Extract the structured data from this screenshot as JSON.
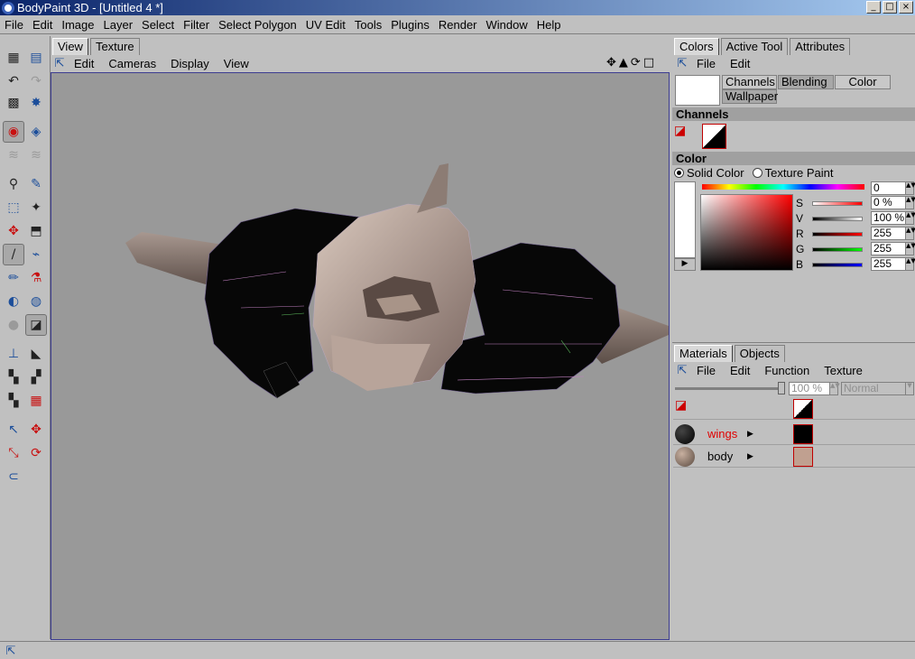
{
  "window": {
    "title": "BodyPaint 3D - [Untitled 4 *]",
    "minimize": "_",
    "maximize": "□",
    "close": "×"
  },
  "menubar": [
    "File",
    "Edit",
    "Image",
    "Layer",
    "Select",
    "Filter",
    "Select Polygon",
    "UV Edit",
    "Tools",
    "Plugins",
    "Render",
    "Window",
    "Help"
  ],
  "viewport": {
    "tabs": [
      "View",
      "Texture"
    ],
    "menu": [
      "Edit",
      "Cameras",
      "Display",
      "View"
    ],
    "controls": [
      "✥",
      "▲",
      "⟳",
      "□"
    ],
    "background": "#999999"
  },
  "colors_panel": {
    "tabs": [
      "Colors",
      "Active Tool",
      "Attributes"
    ],
    "menu": [
      "File",
      "Edit"
    ],
    "channel_buttons": [
      "Channels",
      "Blending",
      "Color",
      "Wallpaper"
    ],
    "channels_header": "Channels",
    "color_header": "Color",
    "mode_solid": "Solid Color",
    "mode_texture": "Texture Paint",
    "top_value": "0",
    "sliders": [
      {
        "label": "S",
        "value": "0 %",
        "gradient": "linear-gradient(90deg,#fff,#f00)"
      },
      {
        "label": "V",
        "value": "100 %",
        "gradient": "linear-gradient(90deg,#000,#fff)"
      },
      {
        "label": "R",
        "value": "255",
        "gradient": "linear-gradient(90deg,#000,#f00)"
      },
      {
        "label": "G",
        "value": "255",
        "gradient": "linear-gradient(90deg,#000,#0f0)"
      },
      {
        "label": "B",
        "value": "255",
        "gradient": "linear-gradient(90deg,#000,#00f)"
      }
    ]
  },
  "materials_panel": {
    "tabs": [
      "Materials",
      "Objects"
    ],
    "menu": [
      "File",
      "Edit",
      "Function",
      "Texture"
    ],
    "opacity": "100 %",
    "blend_mode": "Normal",
    "materials": [
      {
        "name": "wings",
        "name_color": "#e00000",
        "ball": "radial-gradient(circle at 35% 35%, #444, #000)",
        "thumb": "#000"
      },
      {
        "name": "body",
        "name_color": "#000000",
        "ball": "radial-gradient(circle at 35% 35%, #c8b0a0, #5a4a40)",
        "thumb": "#c0a090"
      }
    ]
  }
}
